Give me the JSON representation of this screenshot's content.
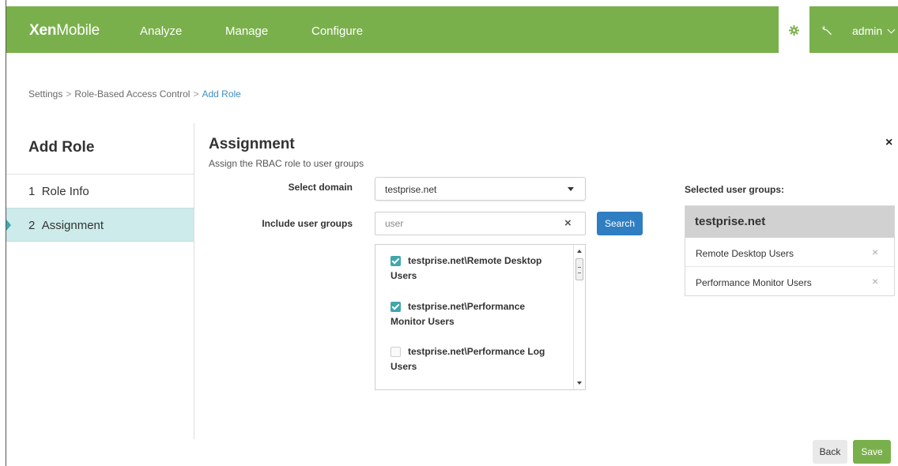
{
  "app": {
    "logo_bold": "Xen",
    "logo_light": "Mobile",
    "nav": [
      "Analyze",
      "Manage",
      "Configure"
    ],
    "user": "admin",
    "brand_color": "#7ab04c",
    "accent_color": "#3fa7ad",
    "link_color": "#3f8fbf"
  },
  "breadcrumb": {
    "items": [
      "Settings",
      "Role-Based Access Control"
    ],
    "current": "Add Role",
    "separator": ">"
  },
  "sidebar": {
    "title": "Add Role",
    "steps": [
      {
        "number": "1",
        "label": "Role Info",
        "active": false
      },
      {
        "number": "2",
        "label": "Assignment",
        "active": true
      }
    ]
  },
  "main": {
    "title": "Assignment",
    "subtitle": "Assign the RBAC role to user groups",
    "close_icon": "×"
  },
  "form": {
    "domain_label": "Select domain",
    "domain_value": "testprise.net",
    "include_label": "Include user groups",
    "search_value": "user",
    "clear_icon": "×",
    "search_button": "Search",
    "groups": [
      {
        "line1": "testprise.net\\Remote Desktop",
        "line2": "Users",
        "checked": true
      },
      {
        "line1": "testprise.net\\Performance",
        "line2": "Monitor Users",
        "checked": true
      },
      {
        "line1": "testprise.net\\Performance Log",
        "line2": "Users",
        "checked": false
      }
    ]
  },
  "selected": {
    "label": "Selected user groups:",
    "domain": "testprise.net",
    "remove_icon": "×",
    "items": [
      "Remote Desktop Users",
      "Performance Monitor Users"
    ]
  },
  "footer": {
    "back": "Back",
    "save": "Save"
  }
}
